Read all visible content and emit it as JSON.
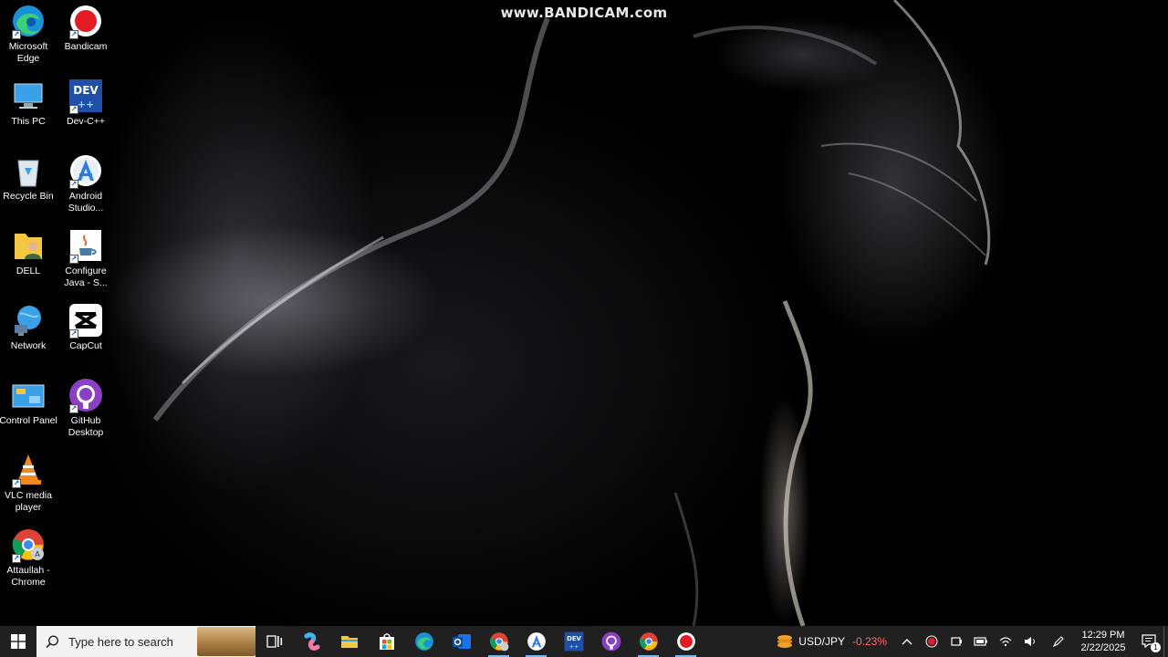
{
  "watermark": "www.BANDICAM.com",
  "desktop_icons": [
    {
      "label": "Microsoft Edge",
      "icon": "edge-icon"
    },
    {
      "label": "Bandicam",
      "icon": "bandicam-icon"
    },
    {
      "label": "This PC",
      "icon": "this-pc-icon"
    },
    {
      "label": "Dev-C++",
      "icon": "devcpp-icon"
    },
    {
      "label": "Recycle Bin",
      "icon": "recycle-bin-icon"
    },
    {
      "label": "Android Studio...",
      "icon": "android-studio-icon"
    },
    {
      "label": "DELL",
      "icon": "user-folder-icon"
    },
    {
      "label": "Configure Java - S...",
      "icon": "java-icon"
    },
    {
      "label": "Network",
      "icon": "network-icon"
    },
    {
      "label": "CapCut",
      "icon": "capcut-icon"
    },
    {
      "label": "Control Panel",
      "icon": "control-panel-icon"
    },
    {
      "label": "GitHub Desktop",
      "icon": "github-icon"
    },
    {
      "label": "VLC media player",
      "icon": "vlc-icon"
    },
    {
      "label": "Attaullah - Chrome",
      "icon": "chrome-icon"
    }
  ],
  "taskbar": {
    "search_placeholder": "Type here to search",
    "pinned": [
      {
        "name": "task-view",
        "icon": "task-view-icon"
      },
      {
        "name": "copilot",
        "icon": "copilot-icon"
      },
      {
        "name": "file-explorer",
        "icon": "folder-icon"
      },
      {
        "name": "microsoft-store",
        "icon": "store-icon"
      },
      {
        "name": "edge",
        "icon": "edge-icon"
      },
      {
        "name": "outlook",
        "icon": "outlook-icon"
      },
      {
        "name": "chrome-profile",
        "icon": "chrome-icon",
        "active": true
      },
      {
        "name": "android-studio",
        "icon": "android-studio-icon",
        "active": true
      },
      {
        "name": "devcpp",
        "icon": "devcpp-icon"
      },
      {
        "name": "github-desktop",
        "icon": "github-icon"
      },
      {
        "name": "chrome",
        "icon": "chrome-icon",
        "active": true
      },
      {
        "name": "bandicam",
        "icon": "bandicam-icon",
        "active": true
      }
    ],
    "widget": {
      "ticker": "USD/JPY",
      "change": "-0.23%"
    },
    "clock": {
      "time": "12:29 PM",
      "date": "2/22/2025"
    },
    "notification_count": "1"
  },
  "colors": {
    "taskbar_bg": "#202020",
    "search_bg": "#f3f3f3",
    "active_indicator": "#76b9ed",
    "negative_change": "#ff6a6a"
  }
}
